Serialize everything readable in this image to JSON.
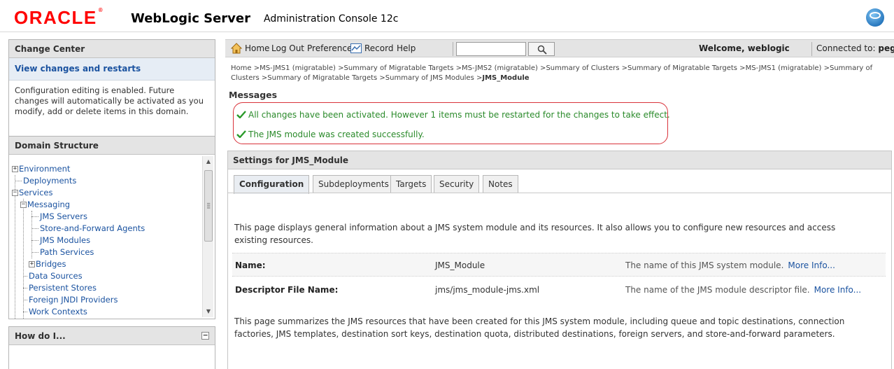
{
  "header": {
    "logo": "ORACLE",
    "logo_tm": "®",
    "product": "WebLogic Server",
    "subproduct": "Administration Console 12c"
  },
  "change_center": {
    "title": "Change Center",
    "link": "View changes and restarts",
    "text": "Configuration editing is enabled. Future changes will automatically be activated as you modify, add or delete items in this domain."
  },
  "domain_structure": {
    "title": "Domain Structure",
    "items": [
      {
        "label": "Environment"
      },
      {
        "label": "Deployments"
      },
      {
        "label": "Services"
      },
      {
        "label": "Messaging"
      },
      {
        "label": "JMS Servers"
      },
      {
        "label": "Store-and-Forward Agents"
      },
      {
        "label": "JMS Modules"
      },
      {
        "label": "Path Services"
      },
      {
        "label": "Bridges"
      },
      {
        "label": "Data Sources"
      },
      {
        "label": "Persistent Stores"
      },
      {
        "label": "Foreign JNDI Providers"
      },
      {
        "label": "Work Contexts"
      }
    ]
  },
  "how_do_i": {
    "title": "How do I..."
  },
  "toolbar": {
    "home": "Home",
    "logout": "Log Out",
    "preferences": "Preferences",
    "record": "Record",
    "help": "Help",
    "search_value": "",
    "welcome": "Welcome, weblogic",
    "connected_label": "Connected to:",
    "connected_domain": "pegjms"
  },
  "breadcrumb": {
    "items": [
      "Home",
      "MS-JMS1 (migratable)",
      "Summary of Migratable Targets",
      "MS-JMS2 (migratable)",
      "Summary of Clusters",
      "Summary of Migratable Targets",
      "MS-JMS1 (migratable)",
      "Summary of Clusters",
      "Summary of Migratable Targets",
      "Summary of JMS Modules"
    ],
    "current": "JMS_Module"
  },
  "messages": {
    "title": "Messages",
    "items": [
      "All changes have been activated. However 1 items must be restarted for the changes to take effect.",
      "The JMS module was created successfully."
    ]
  },
  "settings": {
    "title": "Settings for JMS_Module",
    "tabs": [
      "Configuration",
      "Subdeployments",
      "Targets",
      "Security",
      "Notes"
    ],
    "active_tab": "Configuration",
    "intro": "This page displays general information about a JMS system module and its resources. It also allows you to configure new resources and access existing resources.",
    "rows": [
      {
        "label": "Name:",
        "value": "JMS_Module",
        "help": "The name of this JMS system module.",
        "more": "More Info..."
      },
      {
        "label": "Descriptor File Name:",
        "value": "jms/jms_module-jms.xml",
        "help": "The name of the JMS module descriptor file.",
        "more": "More Info..."
      }
    ],
    "summary": "This page summarizes the JMS resources that have been created for this JMS system module, including queue and topic destinations, connection factories, JMS templates, destination sort keys, destination quota, distributed destinations, foreign servers, and store-and-forward parameters."
  },
  "colors": {
    "oracle_red": "#ff0000",
    "link_blue": "#1b53a0",
    "success_green": "#2a8a2a",
    "highlight_red": "#d9333b",
    "header_gray": "#e4e4e4"
  },
  "icons": [
    "home-icon",
    "record-icon",
    "search-icon",
    "check-icon",
    "globe-icon",
    "plus-icon",
    "minus-icon",
    "collapse-icon"
  ]
}
